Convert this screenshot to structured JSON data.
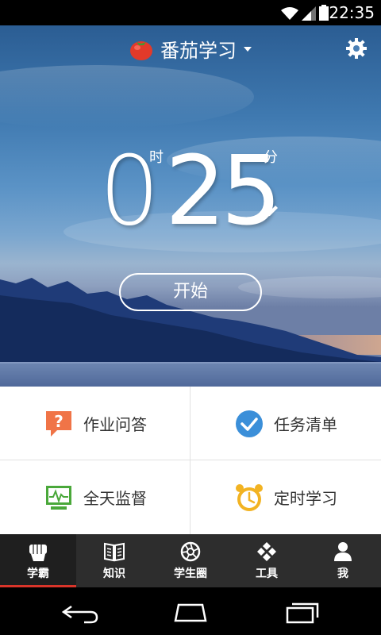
{
  "status_bar": {
    "time": "22:35"
  },
  "header": {
    "app_title": "番茄学习"
  },
  "timer": {
    "hours": "0",
    "hour_unit": "时",
    "minutes": "25",
    "minute_unit": "分"
  },
  "start_button": {
    "label": "开始"
  },
  "features": [
    {
      "label": "作业问答",
      "icon": "question-bubble-icon"
    },
    {
      "label": "任务清单",
      "icon": "checkmark-circle-icon"
    },
    {
      "label": "全天监督",
      "icon": "monitor-pulse-icon"
    },
    {
      "label": "定时学习",
      "icon": "alarm-clock-icon"
    }
  ],
  "tabs": [
    {
      "label": "学霸",
      "icon": "fist-icon",
      "active": true
    },
    {
      "label": "知识",
      "icon": "book-icon",
      "active": false
    },
    {
      "label": "学生圈",
      "icon": "aperture-icon",
      "active": false
    },
    {
      "label": "工具",
      "icon": "diamond-grid-icon",
      "active": false
    },
    {
      "label": "我",
      "icon": "person-icon",
      "active": false
    }
  ],
  "colors": {
    "tab_bar": "#2d2d2d",
    "active_tab_indicator": "#d9352a",
    "question_icon": "#f07447",
    "check_icon": "#3b8fd9",
    "monitor_icon": "#4aa83a",
    "alarm_icon": "#f2b322"
  }
}
